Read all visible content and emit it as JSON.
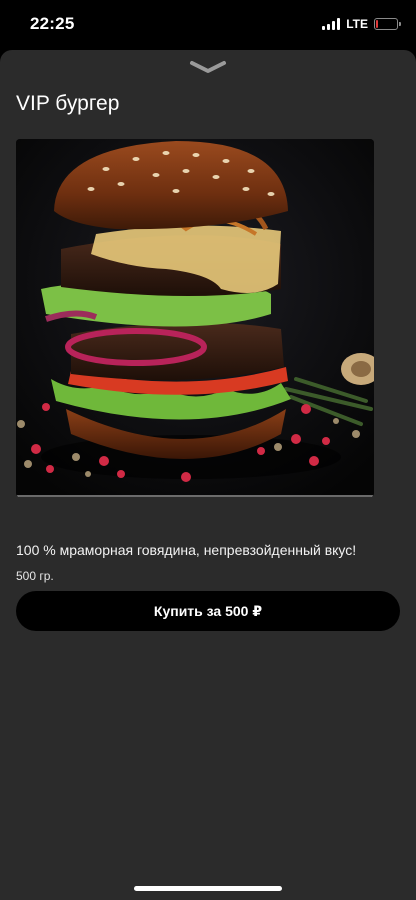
{
  "status_bar": {
    "time": "22:25",
    "network": "LTE",
    "signal_icon": "signal-bars-icon",
    "battery_icon": "battery-icon",
    "battery_level": 0.1,
    "battery_color": "#e03a3a"
  },
  "sheet": {
    "handle_icon": "chevron-down-icon",
    "background_color": "#2b2b2b"
  },
  "product": {
    "title": "VIP бургер",
    "image": "burger-image",
    "description": "100 % мраморная говядина, непревзойденный вкус!",
    "weight": "500 гр.",
    "buy_label": "Купить за 500 ₽",
    "button_color": "#000000"
  }
}
